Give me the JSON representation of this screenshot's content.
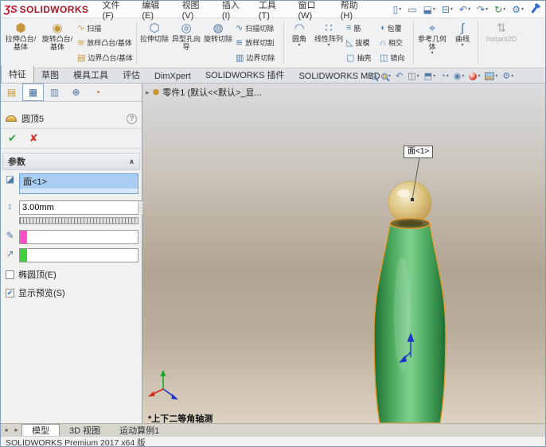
{
  "app": {
    "logo_mark": "ƷS",
    "logo_text": "SOLIDWORKS",
    "status_bar": "SOLIDWORKS Premium 2017 x64 版"
  },
  "menu": {
    "items": [
      "文件(F)",
      "编辑(E)",
      "视图(V)",
      "插入(I)",
      "工具(T)",
      "窗口(W)",
      "帮助(H)"
    ]
  },
  "icons": {
    "new_doc": "▯",
    "open": "▭",
    "save": "⬓",
    "print": "⊟",
    "undo": "↶",
    "redo": "↷",
    "rebuild": "↻",
    "options": "⚙",
    "dropdown": "▾",
    "extrude_boss": "⬢",
    "revolve_boss": "◉",
    "sweep": "∿",
    "loft_boss": "≋",
    "boundary_boss": "▤",
    "extrude_cut": "⬡",
    "hole_wizard": "◎",
    "revolve_cut": "◍",
    "sweep_cut": "∿",
    "loft_cut": "≋",
    "boundary_cut": "▥",
    "fillet": "◠",
    "linear_pattern": "∷",
    "rib": "≡",
    "draft": "◺",
    "shell": "▢",
    "wrap": "◖",
    "intersect": "∩",
    "mirror": "◫",
    "ref_geometry": "⌖",
    "curves": "∫",
    "instant3d": "⇅",
    "prev_view": "↶",
    "section_view": "◫",
    "view_orientation": "⬒",
    "display_style": "◔",
    "hide_show": "◉",
    "view_settings": "⚙",
    "tab_feature_tree": "▤",
    "tab_property": "▦",
    "tab_config": "▥",
    "tab_dimxpert": "⊕",
    "tab_display": "◔",
    "face_select": "◪",
    "distance": "↕",
    "constraint": "✎",
    "direction": "↗",
    "ok": "✔",
    "cancel": "✘",
    "help": "?",
    "collapse": "∧",
    "tree_expand": "▸",
    "part": "⬢",
    "scroll_left": "◂",
    "scroll_right": "▸",
    "spin_up": "▴",
    "spin_down": "▾"
  },
  "ribbon": {
    "buttons": {
      "extrude_boss": "拉伸凸台/基体",
      "revolve_boss": "旋转凸台/基体",
      "sweep": "扫描",
      "loft_boss": "放样凸台/基体",
      "boundary_boss": "边界凸台/基体",
      "extrude_cut": "拉伸切除",
      "hole_wizard": "异型孔向导",
      "revolve_cut": "旋转切除",
      "sweep_cut": "扫描切除",
      "loft_cut": "放样切割",
      "boundary_cut": "边界切除",
      "fillet": "圆角",
      "linear_pattern": "线性阵列",
      "rib": "筋",
      "draft": "拔模",
      "shell": "抽壳",
      "wrap": "包覆",
      "intersect": "相交",
      "mirror": "镜向",
      "ref_geometry": "参考几何体",
      "curves": "曲线",
      "instant3d": "Instant3D"
    },
    "tabs": [
      "特征",
      "草图",
      "模具工具",
      "评估",
      "DimXpert",
      "SOLIDWORKS 插件",
      "SOLIDWORKS MBD"
    ],
    "active_tab": "特征"
  },
  "feature_tree": {
    "root_label": "零件1 (默认<<默认>_显..."
  },
  "property_manager": {
    "title": "圆顶5",
    "section_parameters": "参数",
    "selection_item": "面<1>",
    "distance_value": "3.00mm",
    "checkbox_elliptical": "椭圆顶(E)",
    "checkbox_preview": "显示预览(S)",
    "colors": {
      "constraint_swatch": "#ff4fc8",
      "direction_swatch": "#3ed13e",
      "selection_fill": "#d6e9fb",
      "selection_row": "#a9cdf0"
    }
  },
  "graphics": {
    "callout_label": "面<1>",
    "view_orientation_label": "*上下二等角轴测",
    "colors": {
      "bottle_green": "#57b86a",
      "bottle_edge": "#e89c33",
      "dome_gold": "#e6cc7a",
      "background_tan": "#b2a492"
    }
  },
  "document_tabs": {
    "items": [
      "模型",
      "3D 视图",
      "运动算例1"
    ],
    "active": "模型"
  }
}
